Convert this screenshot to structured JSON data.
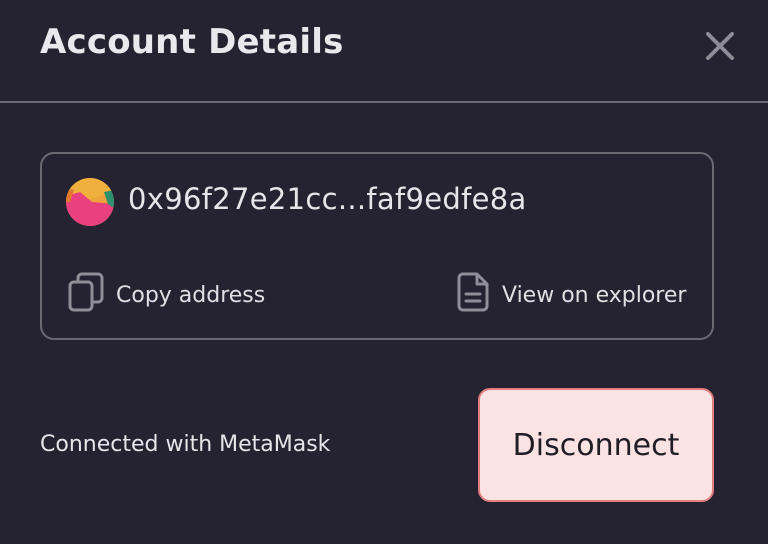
{
  "modal": {
    "title": "Account Details"
  },
  "account": {
    "address": "0x96f27e21cc...faf9edfe8a",
    "copy_label": "Copy address",
    "explorer_label": "View on explorer"
  },
  "footer": {
    "connected_text": "Connected with MetaMask",
    "disconnect_label": "Disconnect"
  },
  "icons": {
    "close": "close-icon",
    "avatar": "avatar",
    "copy": "copy-icon",
    "explorer": "document-icon"
  },
  "colors": {
    "background": "#252331",
    "border": "#6b6974",
    "text": "#e6e5ea",
    "disconnect_bg": "#fbe3e4",
    "disconnect_border": "#e27d80",
    "avatar_orange": "#eea23a",
    "avatar_pink": "#e9407f",
    "avatar_green": "#2f8f6f"
  }
}
